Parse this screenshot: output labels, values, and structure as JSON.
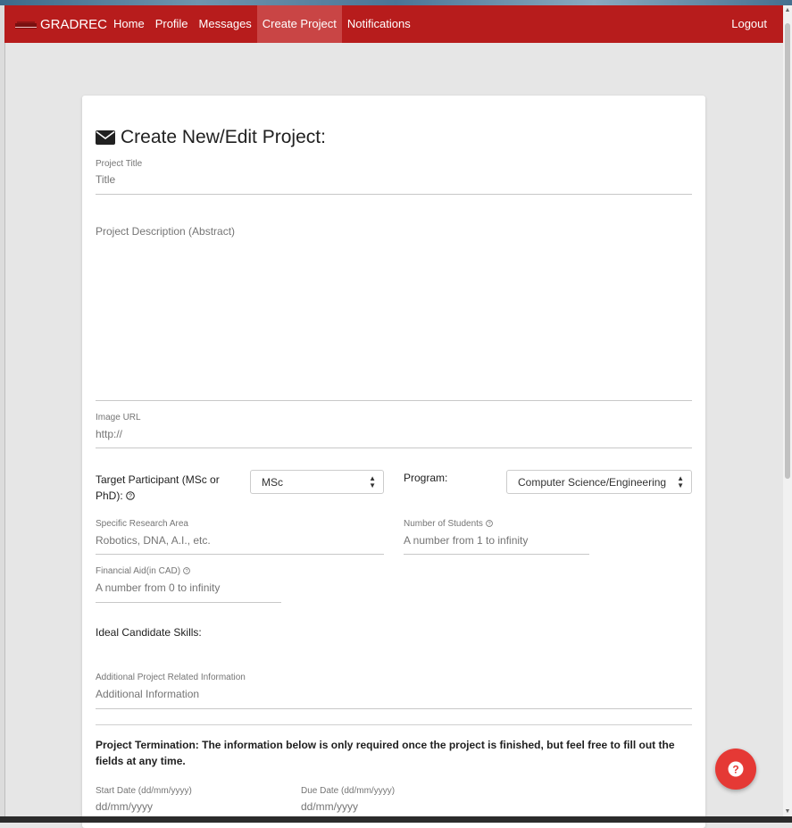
{
  "navbar": {
    "brand": "GRADREC",
    "links": [
      "Home",
      "Profile",
      "Messages",
      "Create Project",
      "Notifications"
    ],
    "active": "Create Project",
    "logout": "Logout"
  },
  "form": {
    "title": "Create New/Edit Project:",
    "project_title": {
      "label": "Project Title",
      "placeholder": "Title"
    },
    "description": {
      "placeholder": "Project Description (Abstract)"
    },
    "image_url": {
      "label": "Image URL",
      "value": "http://"
    },
    "target_participant": {
      "label": "Target Participant (MSc or PhD):",
      "selected": "MSc"
    },
    "program": {
      "label": "Program:",
      "selected": "Computer Science/Engineering"
    },
    "research_area": {
      "label": "Specific Research Area",
      "placeholder": "Robotics, DNA, A.I., etc."
    },
    "num_students": {
      "label": "Number of Students",
      "placeholder": "A number from 1 to infinity"
    },
    "financial_aid": {
      "label": "Financial Aid(in CAD)",
      "placeholder": "A number from 0 to infinity"
    },
    "skills": {
      "label": "Ideal Candidate Skills:"
    },
    "additional_info": {
      "label": "Additional Project Related Information",
      "placeholder": "Additional Information"
    },
    "termination_note": "Project Termination: The information below is only required once the project is finished, but feel free to fill out the fields at any time.",
    "start_date": {
      "label": "Start Date (dd/mm/yyyy)",
      "placeholder": "dd/mm/yyyy"
    },
    "due_date": {
      "label": "Due Date (dd/mm/yyyy)",
      "placeholder": "dd/mm/yyyy"
    }
  },
  "colors": {
    "navbar": "#b71c1c",
    "active_tab": "#c94545",
    "fab": "#e53935"
  },
  "icons": {
    "title": "envelope-icon",
    "help": "question-circle-icon",
    "fab": "question-circle-icon"
  }
}
